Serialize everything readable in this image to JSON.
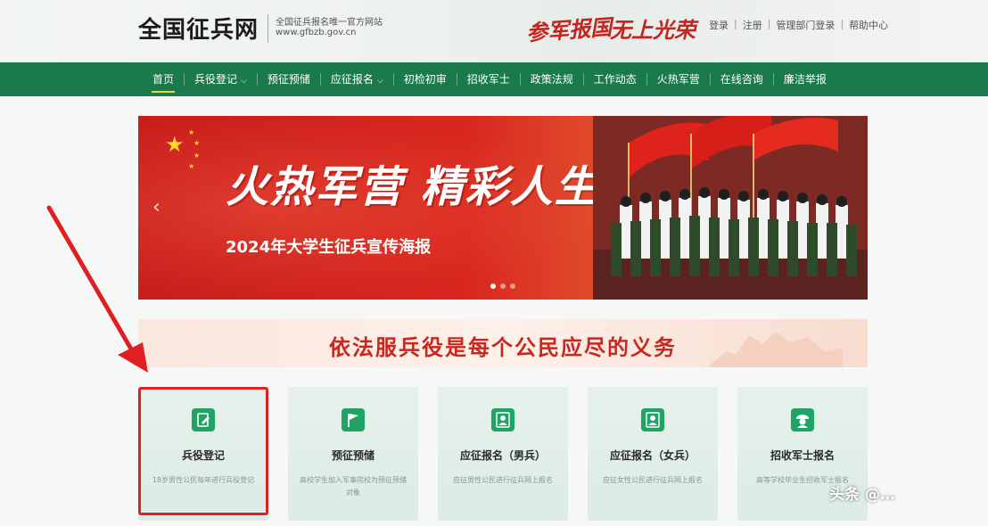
{
  "header": {
    "logo": "全国征兵网",
    "sub_line1": "全国征兵报名唯一官方网站",
    "sub_line2": "www.gfbzb.gov.cn",
    "slogan1": "参军报国",
    "slogan2": "无上光荣",
    "links": [
      "登录",
      "注册",
      "管理部门登录",
      "帮助中心"
    ]
  },
  "nav": {
    "items": [
      {
        "label": "首页",
        "active": true,
        "dropdown": false
      },
      {
        "label": "兵役登记",
        "active": false,
        "dropdown": true
      },
      {
        "label": "预征预储",
        "active": false,
        "dropdown": false
      },
      {
        "label": "应征报名",
        "active": false,
        "dropdown": true
      },
      {
        "label": "初检初审",
        "active": false,
        "dropdown": false
      },
      {
        "label": "招收军士",
        "active": false,
        "dropdown": false
      },
      {
        "label": "政策法规",
        "active": false,
        "dropdown": false
      },
      {
        "label": "工作动态",
        "active": false,
        "dropdown": false
      },
      {
        "label": "火热军营",
        "active": false,
        "dropdown": false
      },
      {
        "label": "在线咨询",
        "active": false,
        "dropdown": false
      },
      {
        "label": "廉洁举报",
        "active": false,
        "dropdown": false
      }
    ]
  },
  "banner": {
    "title": "火热军营 精彩人生",
    "subtitle": "2024年大学生征兵宣传海报",
    "prev_icon": "chevron-left-icon",
    "slide_count": 3,
    "active_slide": 1
  },
  "strip": {
    "text": "依法服兵役是每个公民应尽的义务"
  },
  "cards": [
    {
      "title": "兵役登记",
      "desc": "18岁男性公民每年进行兵役登记",
      "icon": "edit-icon"
    },
    {
      "title": "预征预储",
      "desc": "高校学生加入军事院校为预征预储对象",
      "icon": "flag-icon"
    },
    {
      "title": "应征报名（男兵）",
      "desc": "应征男性公民进行征兵网上报名",
      "icon": "person-icon"
    },
    {
      "title": "应征报名（女兵）",
      "desc": "应征女性公民进行征兵网上报名",
      "icon": "person-icon"
    },
    {
      "title": "招收军士报名",
      "desc": "高等学校毕业生招收军士报名",
      "icon": "soldier-icon"
    }
  ],
  "watermark": "头条 @…",
  "colors": {
    "nav_green": "#1a7a4c",
    "accent_red": "#c8281e",
    "card_icon_green": "#22a366",
    "highlight_red": "#e02020"
  }
}
